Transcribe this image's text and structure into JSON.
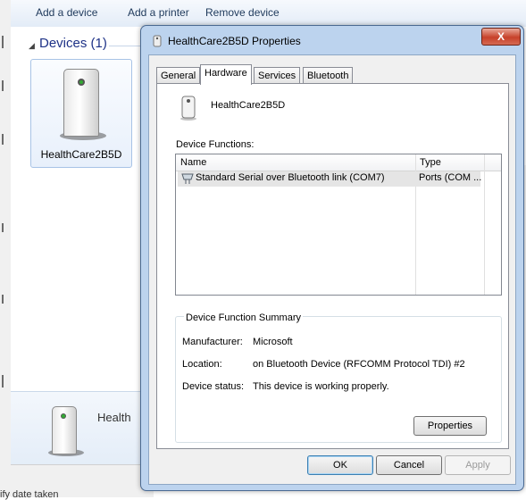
{
  "toolbar": {
    "add_device": "Add a device",
    "add_printer": "Add a printer",
    "remove_device": "Remove device"
  },
  "devices": {
    "group_header": "Devices (1)",
    "device_name": "HealthCare2B5D",
    "details_name": "Health",
    "status_text": "ify date taken"
  },
  "dialog": {
    "title": "HealthCare2B5D Properties",
    "close_label": "X",
    "tabs": [
      "General",
      "Hardware",
      "Services",
      "Bluetooth"
    ],
    "active_tab": "Hardware",
    "device_name": "HealthCare2B5D",
    "functions_label": "Device Functions:",
    "columns": [
      "Name",
      "Type"
    ],
    "rows": [
      {
        "name": "Standard Serial over Bluetooth link (COM7)",
        "type": "Ports (COM ..."
      }
    ],
    "summary_legend": "Device Function Summary",
    "summary": {
      "manufacturer_label": "Manufacturer:",
      "manufacturer": "Microsoft",
      "location_label": "Location:",
      "location": "on Bluetooth Device (RFCOMM Protocol TDI) #2",
      "status_label": "Device status:",
      "status": "This device is working properly."
    },
    "properties_button": "Properties",
    "ok_button": "OK",
    "cancel_button": "Cancel",
    "apply_button": "Apply"
  },
  "colors": {
    "toolbar_text": "#1e395b",
    "group_header": "#1e3287",
    "dialog_frame": "#bcd3ee",
    "close_button": "#c7412a"
  },
  "icons": [
    "device-tower-icon",
    "serial-port-icon",
    "close-icon",
    "collapse-arrow-icon"
  ]
}
